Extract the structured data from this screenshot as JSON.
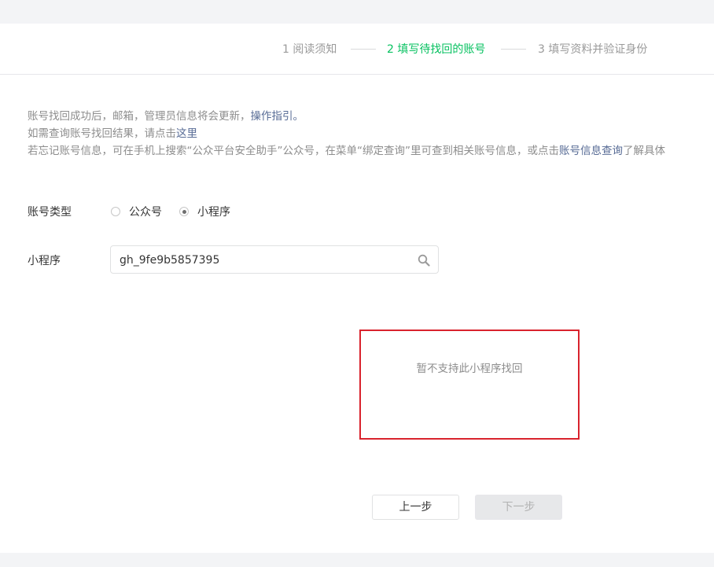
{
  "steps": [
    {
      "label": "1 阅读须知",
      "state": "done"
    },
    {
      "label": "2 填写待找回的账号",
      "state": "active"
    },
    {
      "label": "3 填写资料并验证身份",
      "state": "todo"
    }
  ],
  "tips": {
    "line1_text": "账号找回成功后，邮箱，管理员信息将会更新，",
    "line1_link": "操作指引。",
    "line2_text": "如需查询账号找回结果，请点击",
    "line2_link": "这里",
    "line3_text": "若忘记账号信息，可在手机上搜索“公众平台安全助手”公众号，在菜单“绑定查询”里可查到相关账号信息，或点击",
    "line3_link": "账号信息查询",
    "line3_suffix": "了解具体"
  },
  "form": {
    "account_type_label": "账号类型",
    "radio_options": [
      {
        "label": "公众号",
        "checked": false
      },
      {
        "label": "小程序",
        "checked": true
      }
    ],
    "miniprogram_label": "小程序",
    "search_value": "gh_9fe9b5857395",
    "search_icon": "search-icon"
  },
  "notice": {
    "text": "暂不支持此小程序找回",
    "border_color": "#d9232d"
  },
  "buttons": {
    "prev_label": "上一步",
    "next_label": "下一步",
    "next_disabled": true
  },
  "colors": {
    "accent": "#07c160",
    "link": "#576b95"
  }
}
